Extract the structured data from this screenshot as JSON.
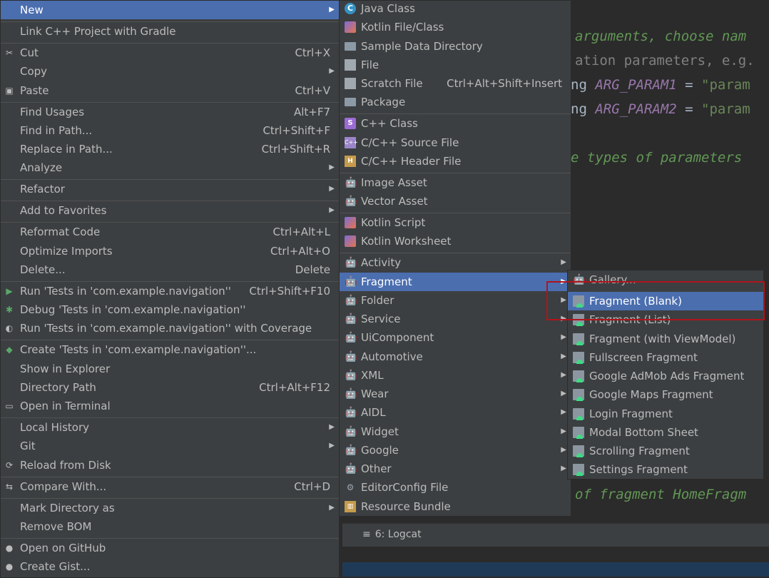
{
  "editor": {
    "lines": [
      {
        "comment": "arguments, choose nam"
      },
      {
        "comment": "ation parameters, e.g."
      },
      {
        "pre": "ng ",
        "const": "ARG_PARAM1",
        "eq": " = ",
        "str": "\"param"
      },
      {
        "pre": "ng ",
        "const": "ARG_PARAM2",
        "eq": " = ",
        "str": "\"param"
      },
      {
        "comment": "e types of parameters"
      },
      {
        "comment": "of fragment HomeFragm"
      }
    ],
    "logcat_tab": "6: Logcat"
  },
  "context_menu": [
    {
      "label": "New",
      "arrow": true,
      "selected": true
    },
    {
      "label": "Link C++ Project with Gradle"
    },
    {
      "label": "Cut",
      "shortcut": "Ctrl+X",
      "icon": "scissors-icon"
    },
    {
      "label": "Copy",
      "arrow": true
    },
    {
      "label": "Paste",
      "shortcut": "Ctrl+V",
      "icon": "clipboard-icon"
    },
    {
      "label": "Find Usages",
      "shortcut": "Alt+F7"
    },
    {
      "label": "Find in Path...",
      "shortcut": "Ctrl+Shift+F"
    },
    {
      "label": "Replace in Path...",
      "shortcut": "Ctrl+Shift+R"
    },
    {
      "label": "Analyze",
      "arrow": true
    },
    {
      "label": "Refactor",
      "arrow": true
    },
    {
      "label": "Add to Favorites",
      "arrow": true
    },
    {
      "label": "Reformat Code",
      "shortcut": "Ctrl+Alt+L"
    },
    {
      "label": "Optimize Imports",
      "shortcut": "Ctrl+Alt+O"
    },
    {
      "label": "Delete...",
      "shortcut": "Delete"
    },
    {
      "label": "Run 'Tests in 'com.example.navigation''",
      "shortcut": "Ctrl+Shift+F10",
      "icon": "run-icon"
    },
    {
      "label": "Debug 'Tests in 'com.example.navigation''",
      "icon": "debug-icon"
    },
    {
      "label": "Run 'Tests in 'com.example.navigation'' with Coverage",
      "icon": "coverage-icon"
    },
    {
      "label": "Create 'Tests in 'com.example.navigation''...",
      "icon": "create-test-icon"
    },
    {
      "label": "Show in Explorer"
    },
    {
      "label": "Directory Path",
      "shortcut": "Ctrl+Alt+F12"
    },
    {
      "label": "Open in Terminal",
      "icon": "terminal-icon"
    },
    {
      "label": "Local History",
      "arrow": true
    },
    {
      "label": "Git",
      "arrow": true
    },
    {
      "label": "Reload from Disk",
      "icon": "reload-icon"
    },
    {
      "label": "Compare With...",
      "shortcut": "Ctrl+D",
      "icon": "compare-icon"
    },
    {
      "label": "Mark Directory as",
      "arrow": true
    },
    {
      "label": "Remove BOM"
    },
    {
      "label": "Open on GitHub",
      "icon": "github-icon"
    },
    {
      "label": "Create Gist...",
      "icon": "github-icon"
    }
  ],
  "new_menu": [
    {
      "label": "Java Class",
      "icon": "java-class-icon"
    },
    {
      "label": "Kotlin File/Class",
      "icon": "kotlin-file-icon"
    },
    {
      "label": "Sample Data Directory",
      "icon": "folder-icon"
    },
    {
      "label": "File",
      "icon": "file-icon"
    },
    {
      "label": "Scratch File",
      "shortcut": "Ctrl+Alt+Shift+Insert",
      "icon": "scratch-file-icon"
    },
    {
      "label": "Package",
      "icon": "package-icon"
    },
    {
      "label": "C++ Class",
      "icon": "cpp-class-icon"
    },
    {
      "label": "C/C++ Source File",
      "icon": "cpp-source-icon"
    },
    {
      "label": "C/C++ Header File",
      "icon": "cpp-header-icon"
    },
    {
      "label": "Image Asset",
      "icon": "android-icon"
    },
    {
      "label": "Vector Asset",
      "icon": "android-icon"
    },
    {
      "label": "Kotlin Script",
      "icon": "kotlin-script-icon"
    },
    {
      "label": "Kotlin Worksheet",
      "icon": "kotlin-worksheet-icon"
    },
    {
      "label": "Activity",
      "icon": "android-icon",
      "arrow": true
    },
    {
      "label": "Fragment",
      "icon": "android-icon",
      "arrow": true,
      "selected": true
    },
    {
      "label": "Folder",
      "icon": "android-icon",
      "arrow": true
    },
    {
      "label": "Service",
      "icon": "android-icon",
      "arrow": true
    },
    {
      "label": "UiComponent",
      "icon": "android-icon",
      "arrow": true
    },
    {
      "label": "Automotive",
      "icon": "android-icon",
      "arrow": true
    },
    {
      "label": "XML",
      "icon": "android-icon",
      "arrow": true
    },
    {
      "label": "Wear",
      "icon": "android-icon",
      "arrow": true
    },
    {
      "label": "AIDL",
      "icon": "android-icon",
      "arrow": true
    },
    {
      "label": "Widget",
      "icon": "android-icon",
      "arrow": true
    },
    {
      "label": "Google",
      "icon": "android-icon",
      "arrow": true
    },
    {
      "label": "Other",
      "icon": "android-icon",
      "arrow": true
    },
    {
      "label": "EditorConfig File",
      "icon": "gear-icon"
    },
    {
      "label": "Resource Bundle",
      "icon": "resource-bundle-icon"
    }
  ],
  "fragment_menu": [
    {
      "label": "Gallery...",
      "icon": "android-icon"
    },
    {
      "label": "Fragment (Blank)",
      "icon": "fragment-template-icon",
      "selected": true
    },
    {
      "label": "Fragment (List)",
      "icon": "fragment-template-icon"
    },
    {
      "label": "Fragment (with ViewModel)",
      "icon": "fragment-template-icon"
    },
    {
      "label": "Fullscreen Fragment",
      "icon": "fragment-template-icon"
    },
    {
      "label": "Google AdMob Ads Fragment",
      "icon": "fragment-template-icon"
    },
    {
      "label": "Google Maps Fragment",
      "icon": "fragment-template-icon"
    },
    {
      "label": "Login Fragment",
      "icon": "fragment-template-icon"
    },
    {
      "label": "Modal Bottom Sheet",
      "icon": "fragment-template-icon"
    },
    {
      "label": "Scrolling Fragment",
      "icon": "fragment-template-icon"
    },
    {
      "label": "Settings Fragment",
      "icon": "fragment-template-icon"
    }
  ],
  "colors": {
    "menu_bg": "#3c3f41",
    "selection": "#4b6eaf",
    "highlight_border": "#b0141b",
    "android_green": "#3ddc84"
  }
}
